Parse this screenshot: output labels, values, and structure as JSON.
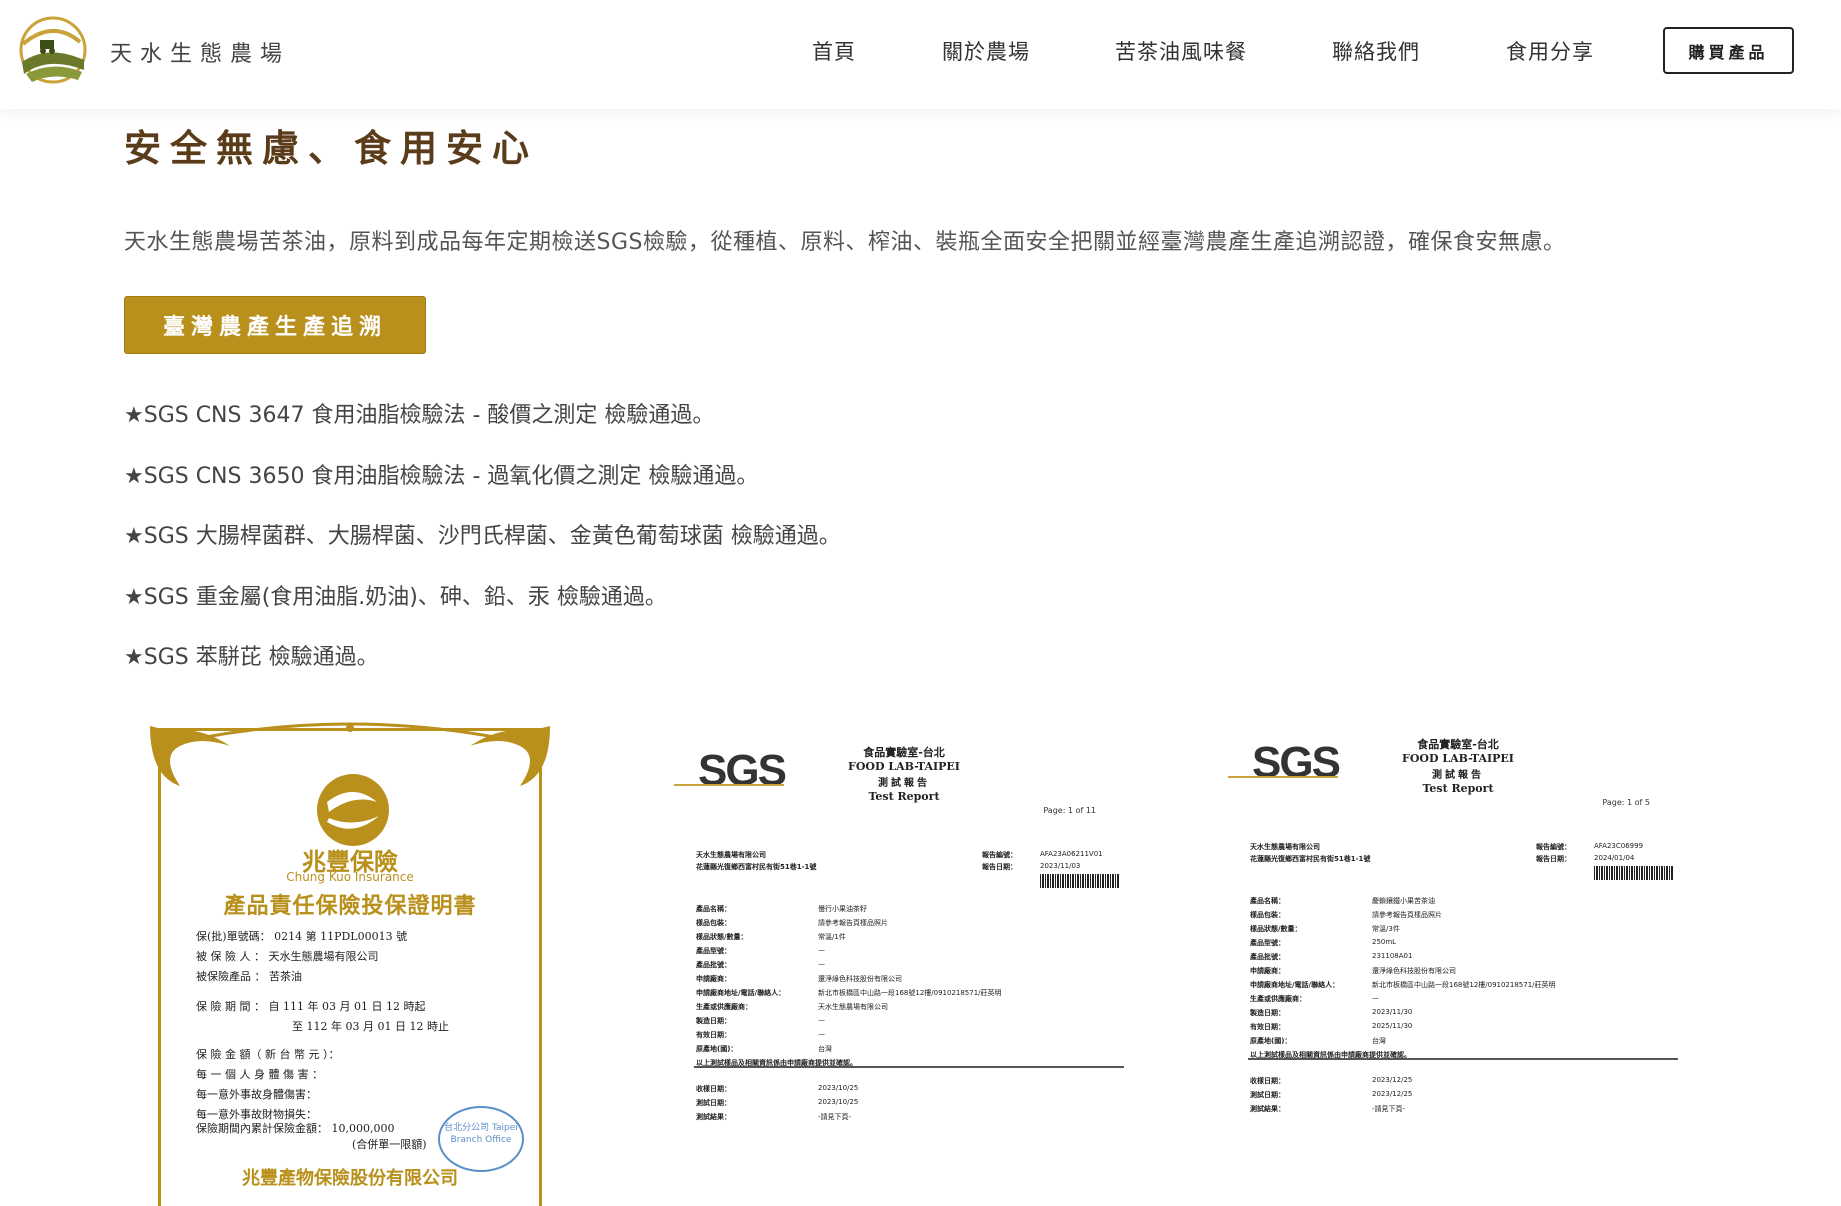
{
  "header": {
    "brand": "天水生態農場",
    "nav": [
      "首頁",
      "關於農場",
      "苦茶油風味餐",
      "聯絡我們",
      "食用分享"
    ],
    "buy_label": "購買產品"
  },
  "main": {
    "title": "安全無慮、食用安心",
    "intro": "天水生態農場苦茶油，原料到成品每年定期檢送SGS檢驗，從種植、原料、榨油、裝瓶全面安全把關並經臺灣農產生產追溯認證，確保食安無慮。",
    "trace_button": "臺灣農產生產追溯",
    "checks": [
      "★SGS CNS 3647 食用油脂檢驗法 - 酸價之測定 檢驗通過。",
      "★SGS CNS 3650 食用油脂檢驗法 - 過氧化價之測定 檢驗通過。",
      "★SGS 大腸桿菌群、大腸桿菌、沙門氏桿菌、金黃色葡萄球菌 檢驗通過。",
      "★SGS 重金屬(食用油脂.奶油)、砷、鉛、汞 檢驗通過。",
      "★SGS 苯駢芘 檢驗通過。"
    ]
  },
  "insurance": {
    "name_zh": "兆豐保險",
    "name_en": "Chung Kuo Insurance",
    "title": "產品責任保險投保證明書",
    "lines": [
      "保(批)單號碼： 0214 第 11PDL00013 號",
      "被 保 險 人 ： 天水生態農場有限公司",
      "被保險產品 ： 苦茶油",
      "保 險 期 間 ： 自 111 年 03 月 01 日 12 時起",
      "至 112 年 03 月 01 日 12 時止",
      "保 險 金 額（ 新 台 幣 元 ）：",
      "每 一 個 人 身 體 傷 害 ：",
      "每一意外事故身體傷害：",
      "每一意外事故財物損失：",
      "保險期間內累計保險金額： 10,000,000",
      "(合併單一限額)"
    ],
    "seal": "台北分公司 Taipei Branch Office",
    "company": "兆豐產物保險股份有限公司"
  },
  "reports": [
    {
      "logo": "SGS",
      "lab_zh": "食品實驗室-台北",
      "lab_en": "FOOD LAB-TAIPEI",
      "report_zh": "測試報告",
      "report_en": "Test Report",
      "page": "Page: 1 of 11",
      "client": "天水生態農場有限公司",
      "address": "花蓮縣光復鄉西富村民有街51巷1-1號",
      "report_no_label": "報告編號：",
      "report_no": "AFA23A06211V01",
      "date_label": "報告日期：",
      "date": "2023/11/03",
      "fields": [
        [
          "產品名稱：",
          "慢行小果油茶籽"
        ],
        [
          "樣品包裝：",
          "請參考報告頁樣品照片"
        ],
        [
          "樣品狀態/數量：",
          "常溫/1件"
        ],
        [
          "產品型號：",
          "—"
        ],
        [
          "產品批號：",
          "—"
        ],
        [
          "申請廠商：",
          "還淨綠色科技股份有限公司"
        ],
        [
          "申請廠商地址/電話/聯絡人：",
          "新北市板橋區中山路一段168號12樓/0910218571/莊英明"
        ],
        [
          "生產或供應廠商：",
          "天水生態農場有限公司"
        ],
        [
          "製造日期：",
          "—"
        ],
        [
          "有效日期：",
          "—"
        ],
        [
          "原產地(國)：",
          "台灣"
        ]
      ],
      "note": "以上測試樣品及相關資訊係由申請廠商提供並確認。",
      "tail": [
        [
          "收樣日期：",
          "2023/10/25"
        ],
        [
          "測試日期：",
          "2023/10/25"
        ],
        [
          "測試結果：",
          "-請見下頁-"
        ]
      ]
    },
    {
      "logo": "SGS",
      "lab_zh": "食品實驗室-台北",
      "lab_en": "FOOD LAB-TAIPEI",
      "report_zh": "測試報告",
      "report_en": "Test Report",
      "page": "Page: 1 of 5",
      "client": "天水生態農場有限公司",
      "address": "花蓮縣光復鄉西富村民有街51巷1-1號",
      "report_no_label": "報告編號：",
      "report_no": "AFA23C06999",
      "date_label": "報告日期：",
      "date": "2024/01/04",
      "fields": [
        [
          "產品名稱：",
          "慶鎖鑲鐵小果苦茶油"
        ],
        [
          "樣品包裝：",
          "請參考報告頁樣品照片"
        ],
        [
          "樣品狀態/數量：",
          "常溫/3件"
        ],
        [
          "產品型號：",
          "250mL"
        ],
        [
          "產品批號：",
          "231108A01"
        ],
        [
          "申請廠商：",
          "還淨綠色科技股份有限公司"
        ],
        [
          "申請廠商地址/電話/聯絡人：",
          "新北市板橋區中山路一段168號12樓/0910218571/莊英明"
        ],
        [
          "生產或供應廠商：",
          "—"
        ],
        [
          "製造日期：",
          "2023/11/30"
        ],
        [
          "有效日期：",
          "2025/11/30"
        ],
        [
          "原產地(國)：",
          "台灣"
        ]
      ],
      "note": "以上測試樣品及相關資訊係由申請廠商提供並確認。",
      "tail": [
        [
          "收樣日期：",
          "2023/12/25"
        ],
        [
          "測試日期：",
          "2023/12/25"
        ],
        [
          "測試結果：",
          "-請見下頁-"
        ]
      ]
    }
  ],
  "colors": {
    "title": "#5a3b1a",
    "button": "#b8901b",
    "gold": "#b8901b"
  }
}
